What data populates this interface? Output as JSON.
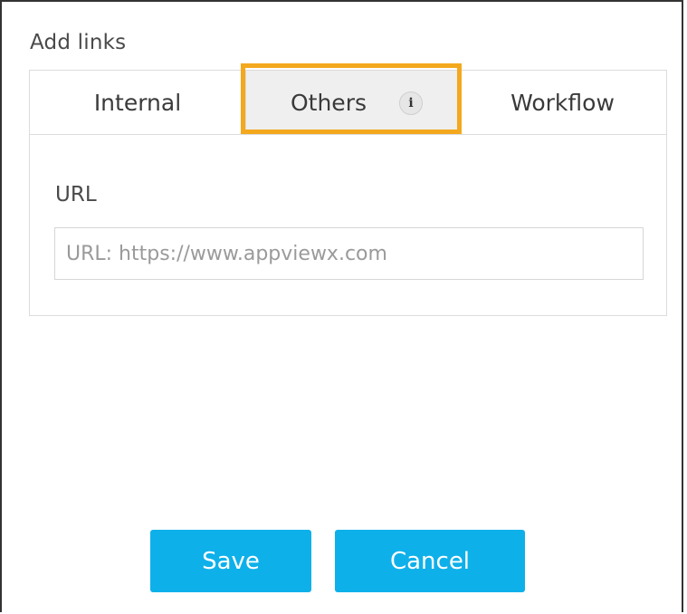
{
  "dialog": {
    "title": "Add links"
  },
  "tabs": {
    "items": [
      {
        "label": "Internal"
      },
      {
        "label": "Others",
        "info_icon_glyph": "i",
        "icon": "info-icon",
        "selected": true
      },
      {
        "label": "Workflow"
      }
    ]
  },
  "url_section": {
    "label": "URL",
    "input_value": "",
    "placeholder": "URL: https://www.appviewx.com"
  },
  "buttons": {
    "save_label": "Save",
    "cancel_label": "Cancel"
  },
  "colors": {
    "accent_button": "#0eb0ea",
    "highlight_border": "#f4a81d",
    "selected_tab_bg": "#efefef"
  }
}
